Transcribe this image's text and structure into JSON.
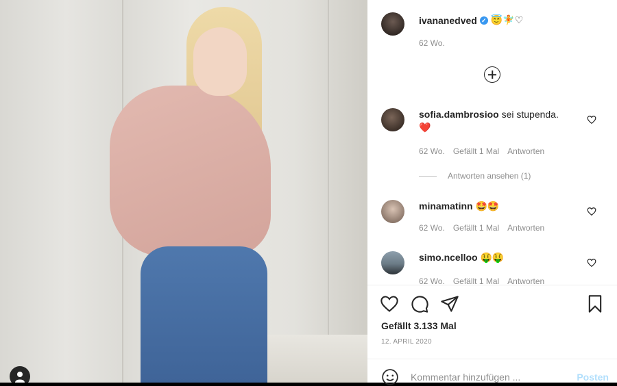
{
  "post": {
    "username": "ivananedved",
    "name_extra": "😇🧚♡",
    "time": "62 Wo."
  },
  "comments": [
    {
      "user": "sofia.dambrosioo",
      "text": "sei stupenda.",
      "emoji_line": "❤️",
      "time": "62 Wo.",
      "likes": "Gefällt 1 Mal",
      "reply": "Antworten",
      "view_replies": "Antworten ansehen (1)"
    },
    {
      "user": "minamatinn",
      "text": "🤩🤩",
      "time": "62 Wo.",
      "likes": "Gefällt 1 Mal",
      "reply": "Antworten"
    },
    {
      "user": "simo.ncelloo",
      "text": "🤑🤑",
      "time": "62 Wo.",
      "likes": "Gefällt 1 Mal",
      "reply": "Antworten"
    }
  ],
  "likes_text": "Gefällt 3.133 Mal",
  "date_text": "12. APRIL 2020",
  "comment_input": {
    "placeholder": "Kommentar hinzufügen ...",
    "post_label": "Posten"
  },
  "icons": [
    "plus-circle-icon",
    "heart-icon",
    "comment-icon",
    "share-icon",
    "bookmark-icon",
    "smiley-icon",
    "user-icon",
    "verified-badge-icon"
  ],
  "colors": {
    "verified": "#3897f0",
    "heart_red": "#ed4956",
    "secondary_text": "#8e8e8e",
    "post_disabled": "#b2dffc"
  }
}
